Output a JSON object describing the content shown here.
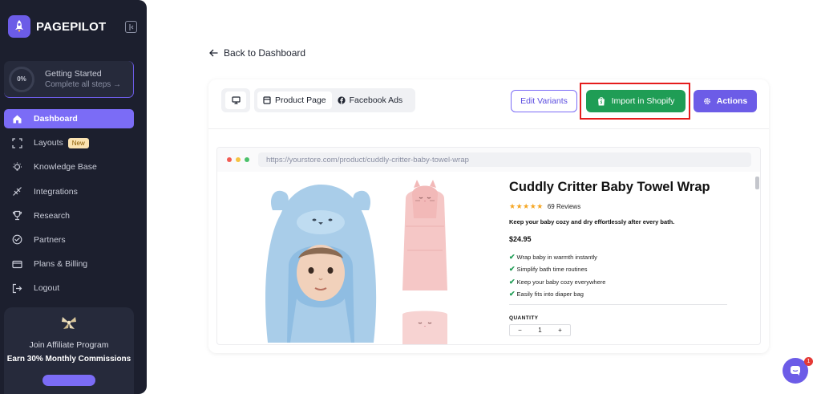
{
  "brand": {
    "name": "PAGEPILOT"
  },
  "getting_started": {
    "progress": "0%",
    "title": "Getting Started",
    "subtitle": "Complete all steps →"
  },
  "nav": {
    "items": [
      {
        "label": "Dashboard",
        "icon": "home-icon",
        "active": true
      },
      {
        "label": "Layouts",
        "icon": "frame-icon",
        "badge": "New"
      },
      {
        "label": "Knowledge Base",
        "icon": "lightbulb-icon"
      },
      {
        "label": "Integrations",
        "icon": "plug-icon"
      },
      {
        "label": "Research",
        "icon": "trophy-icon"
      },
      {
        "label": "Partners",
        "icon": "partners-icon"
      },
      {
        "label": "Plans & Billing",
        "icon": "credit-card-icon"
      },
      {
        "label": "Logout",
        "icon": "logout-icon"
      }
    ]
  },
  "affiliate": {
    "title": "Join Affiliate Program",
    "subtitle": "Earn 30% Monthly Commissions"
  },
  "back_link": "Back to Dashboard",
  "toolbar": {
    "tabs": [
      {
        "label": "Product Page",
        "active": true
      },
      {
        "label": "Facebook Ads",
        "active": false
      }
    ],
    "edit_variants": "Edit Variants",
    "import_shopify": "Import in Shopify",
    "actions": "Actions"
  },
  "browser": {
    "url": "https://yourstore.com/product/cuddly-critter-baby-towel-wrap"
  },
  "product": {
    "title": "Cuddly Critter Baby Towel Wrap",
    "stars": "★★★★★",
    "reviews": "69 Reviews",
    "description": "Keep your baby cozy and dry effortlessly after every bath.",
    "price": "$24.95",
    "features": [
      "Wrap baby in warmth instantly",
      "Simplify bath time routines",
      "Keep your baby cozy everywhere",
      "Easily fits into diaper bag"
    ],
    "quantity_label": "QUANTITY",
    "quantity_value": "1",
    "minus": "−",
    "plus": "+"
  },
  "chat": {
    "badge": "1"
  },
  "colors": {
    "sidebar": "#1c1f2e",
    "accent": "#6c5ce7",
    "shopify_green": "#1f9d55",
    "highlight_red": "#e51c1c"
  }
}
